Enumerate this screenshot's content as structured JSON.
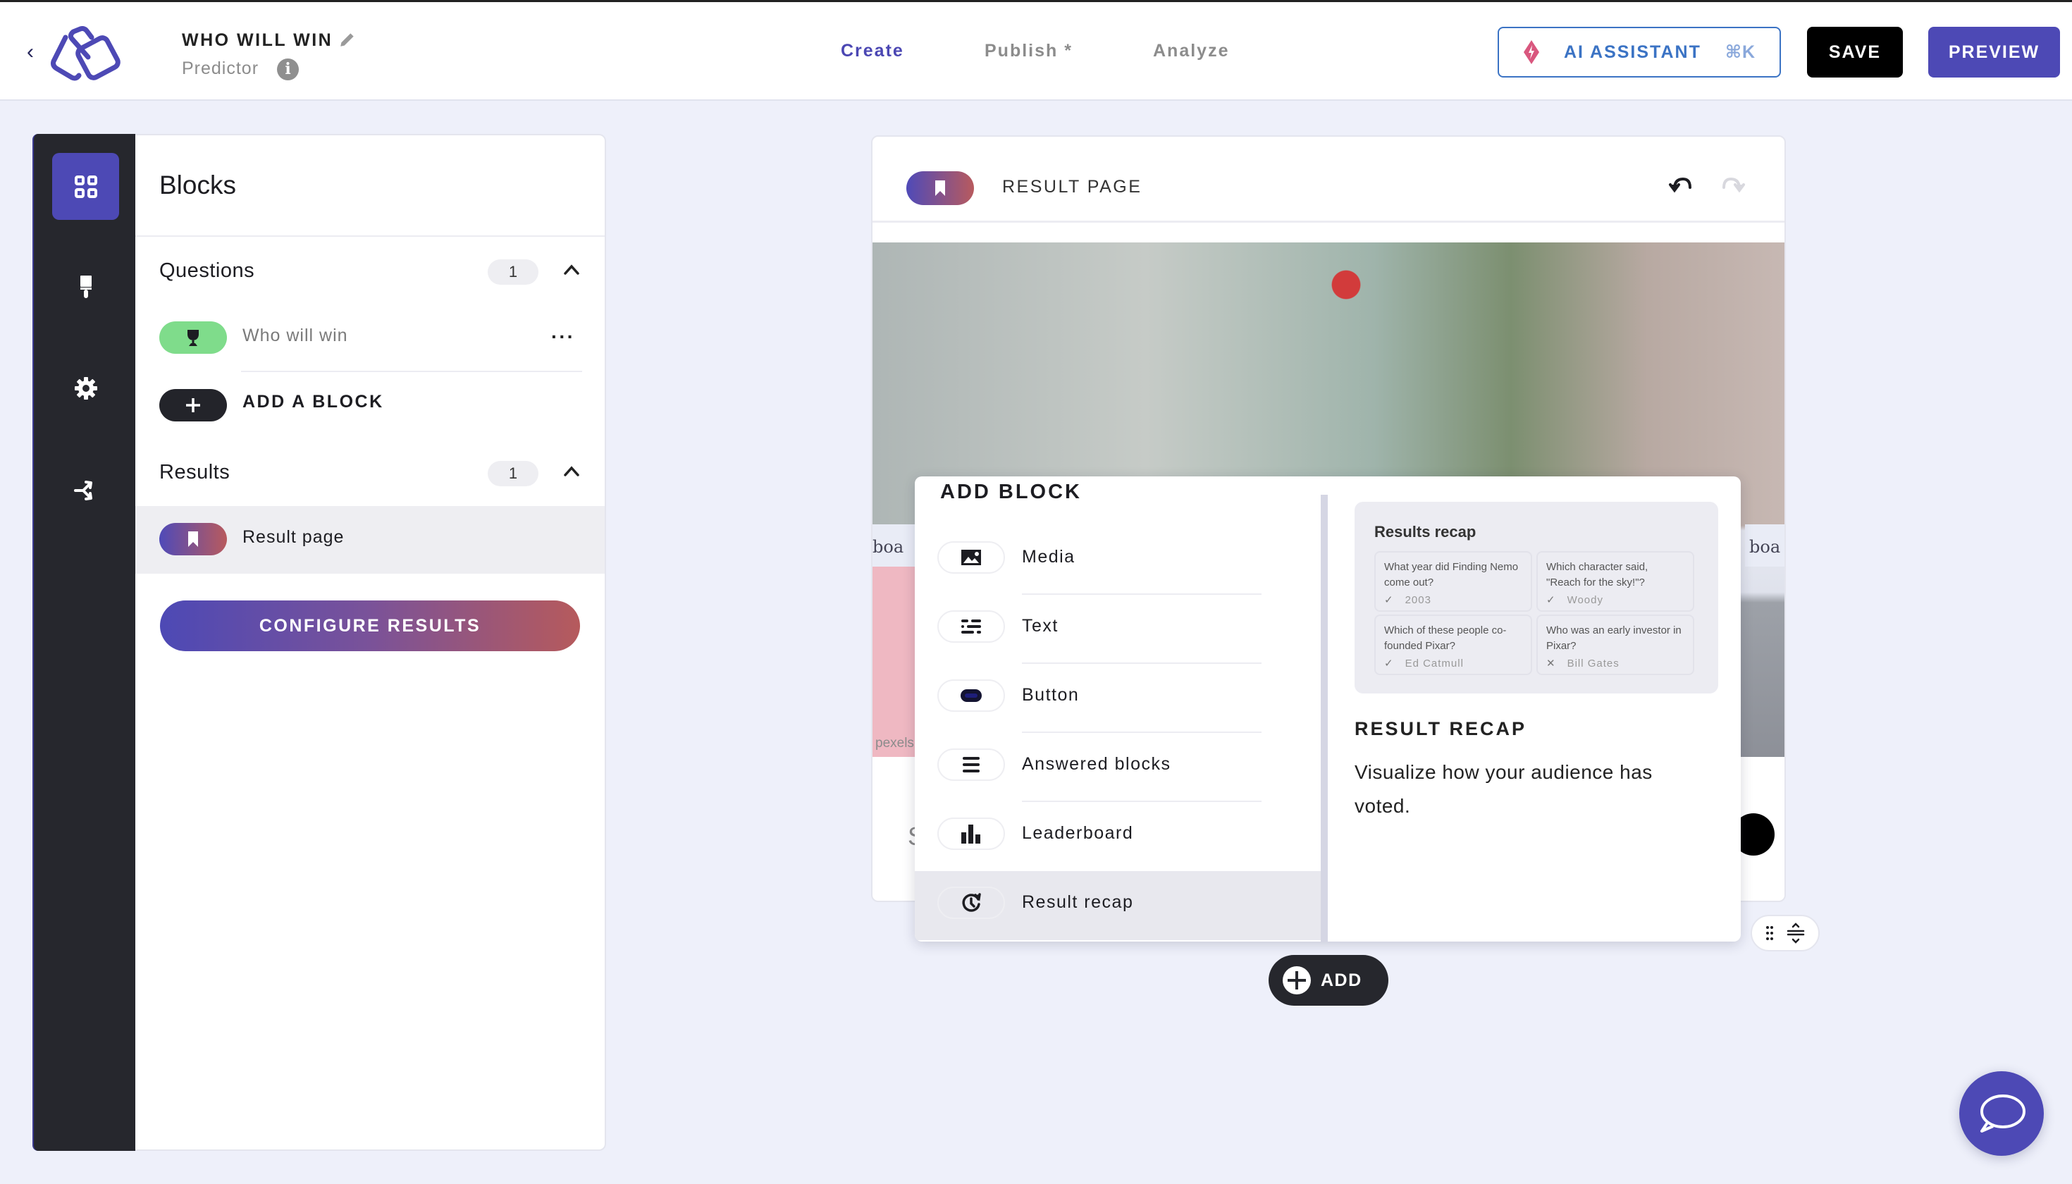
{
  "header": {
    "title": "WHO WILL WIN",
    "subtitle": "Predictor",
    "tabs": [
      {
        "label": "Create",
        "active": true
      },
      {
        "label": "Publish *",
        "active": false
      },
      {
        "label": "Analyze",
        "active": false
      }
    ],
    "ai_assistant": {
      "label": "AI ASSISTANT",
      "shortcut": "⌘K"
    },
    "save_label": "SAVE",
    "preview_label": "PREVIEW",
    "accent_color": "#4d49b5"
  },
  "rail": {
    "items": [
      {
        "icon": "grid-icon",
        "active": true
      },
      {
        "icon": "paint-brush-icon",
        "active": false
      },
      {
        "icon": "gear-icon",
        "active": false
      },
      {
        "icon": "branch-icon",
        "active": false
      }
    ]
  },
  "panel": {
    "title": "Blocks",
    "questions": {
      "label": "Questions",
      "count": "1",
      "items": [
        {
          "label": "Who will win",
          "icon": "trophy-icon"
        }
      ]
    },
    "add_block_label": "ADD A BLOCK",
    "results": {
      "label": "Results",
      "count": "1",
      "items": [
        {
          "label": "Result page",
          "icon": "bookmark-icon",
          "selected": true
        }
      ]
    },
    "configure_label": "CONFIGURE RESULTS"
  },
  "card": {
    "title": "RESULT PAGE",
    "image_credit": "pexels",
    "hero_text_left": "boa",
    "hero_text_right": "boa",
    "bottom_text_partial": "S"
  },
  "add_block": {
    "title": "ADD BLOCK",
    "options": [
      {
        "label": "Media",
        "icon": "image-icon"
      },
      {
        "label": "Text",
        "icon": "text-lines-icon"
      },
      {
        "label": "Button",
        "icon": "button-icon"
      },
      {
        "label": "Answered blocks",
        "icon": "list-icon"
      },
      {
        "label": "Leaderboard",
        "icon": "bar-chart-icon"
      },
      {
        "label": "Result recap",
        "icon": "history-icon",
        "hovered": true
      }
    ],
    "preview": {
      "heading": "Results recap",
      "cells": [
        {
          "question": "What year did Finding Nemo come out?",
          "answer": "2003",
          "correct": true
        },
        {
          "question": "Which character said, \"Reach for the sky!\"?",
          "answer": "Woody",
          "correct": true
        },
        {
          "question": "Which of these people co-founded Pixar?",
          "answer": "Ed Catmull",
          "correct": true
        },
        {
          "question": "Who was an early investor in Pixar?",
          "answer": "Bill Gates",
          "correct": false
        }
      ]
    },
    "detail_title": "RESULT RECAP",
    "detail_description": "Visualize how your audience has voted."
  },
  "add_button_label": "ADD"
}
